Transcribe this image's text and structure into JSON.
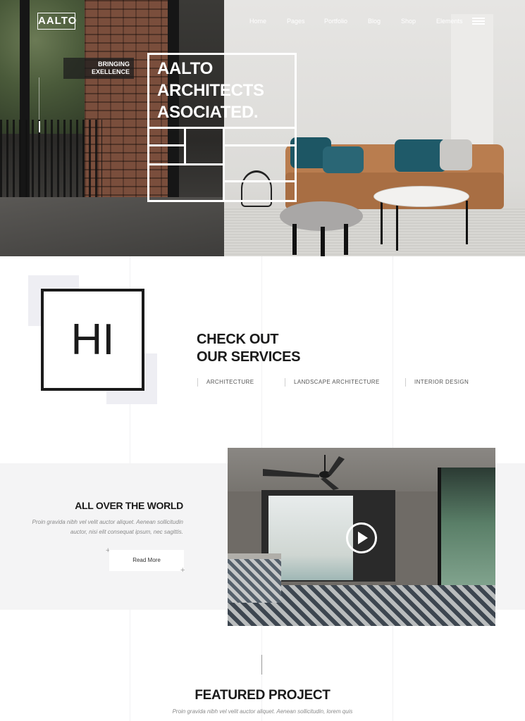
{
  "brand": {
    "logo_text": "AALTO"
  },
  "nav": {
    "items": [
      {
        "label": "Home"
      },
      {
        "label": "Pages"
      },
      {
        "label": "Portfolio"
      },
      {
        "label": "Blog"
      },
      {
        "label": "Shop"
      },
      {
        "label": "Elements"
      }
    ],
    "menu_icon": "hamburger-menu-icon"
  },
  "hero": {
    "tagline": [
      "BRINGING",
      "EXELLENCE"
    ],
    "title_lines": [
      "AALTO",
      "ARCHITECTS",
      "ASOCIATED."
    ]
  },
  "intro": {
    "hi_text": "HI",
    "services_title": [
      "CHECK OUT",
      "OUR SERVICES"
    ],
    "services": [
      "ARCHITECTURE",
      "LANDSCAPE ARCHITECTURE",
      "INTERIOR DESIGN"
    ]
  },
  "world": {
    "title": "ALL OVER THE WORLD",
    "body": "Proin gravida nibh vel velit auctor aliquet. Aenean sollicitudin auctor, nisi elit consequat ipsum, nec sagittis.",
    "button_label": "Read More",
    "video_icon": "play-icon"
  },
  "featured": {
    "title": "FEATURED PROJECT",
    "body": "Proin gravida nibh vel velit auctor aliquet. Aenean sollicitudin, lorem quis"
  },
  "colors": {
    "text": "#1a1a1a",
    "muted": "#8a8a8a",
    "band": "#f4f4f5",
    "deco": "#eeeef3",
    "white": "#ffffff"
  }
}
